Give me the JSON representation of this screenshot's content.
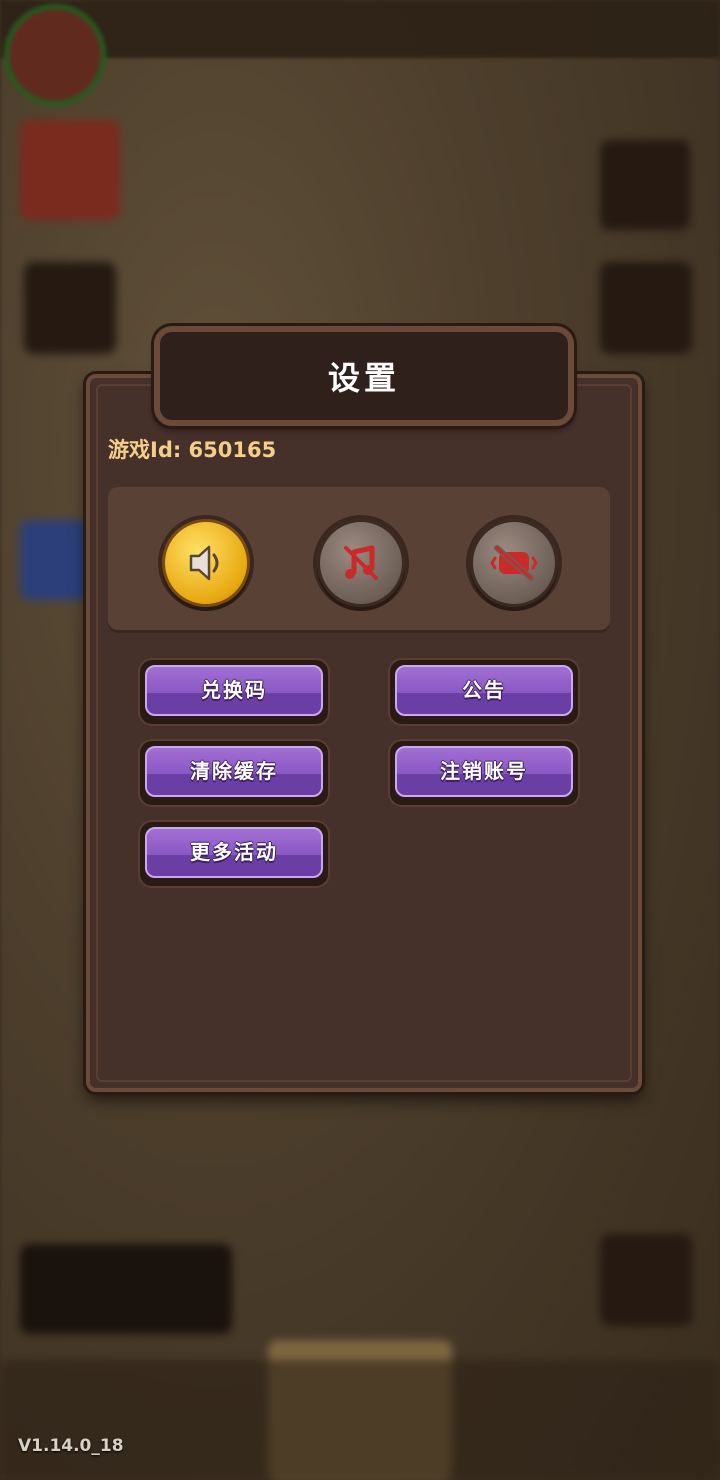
{
  "version": "V1.14.0_18",
  "settings": {
    "title": "设置",
    "game_id_label": "游戏Id: 650165",
    "toggles": [
      {
        "name": "sound",
        "state": "on",
        "icon": "speaker-icon"
      },
      {
        "name": "music",
        "state": "off",
        "icon": "music-note-muted-icon"
      },
      {
        "name": "vibration",
        "state": "off",
        "icon": "vibration-muted-icon"
      }
    ],
    "buttons": {
      "redeem_code": "兑换码",
      "announcement": "公告",
      "clear_cache": "清除缓存",
      "delete_account": "注销账号",
      "more_events": "更多活动"
    }
  },
  "colors": {
    "dialog_bg": "#45302a",
    "button_purple": "#8a58c4",
    "id_text": "#f5cf8a",
    "active_toggle": "#e8a810"
  }
}
